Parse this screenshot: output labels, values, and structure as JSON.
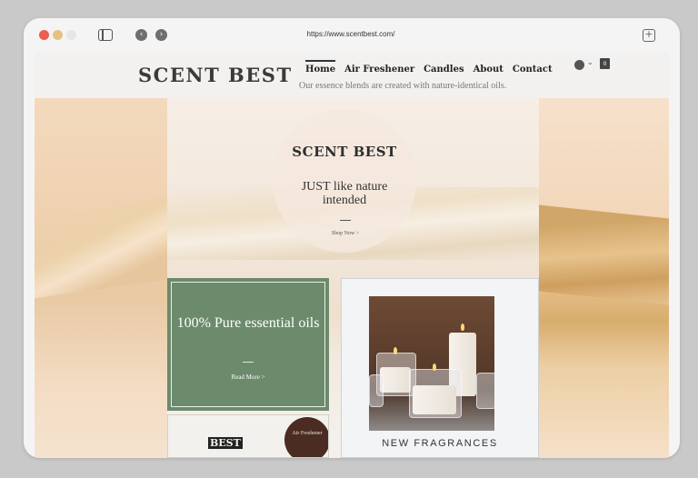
{
  "browser": {
    "url": "https://www.scentbest.com/",
    "back_glyph": "‹",
    "forward_glyph": "›",
    "newtab_glyph": "+"
  },
  "header": {
    "logo": "SCENT BEST",
    "menu": [
      "Home",
      "Air Freshener",
      "Candles",
      "About",
      "Contact"
    ],
    "tagline": "Our essence blends are created with nature-identical oils.",
    "chevron": "⌄",
    "cart_count": "0"
  },
  "hero": {
    "title": "SCENT BEST",
    "subtitle": "JUST like nature intended",
    "cta": "Shop Now >"
  },
  "cards": {
    "oils": {
      "title": "100% Pure essential oils",
      "link": "Read More >"
    },
    "fragrances": {
      "title": "NEW FRAGRANCES"
    },
    "bottom": {
      "logo": "BEST",
      "badge": "Air Freshener"
    }
  },
  "colors": {
    "accent_green": "#6c8a6c",
    "badge_brown": "#4a2c22"
  }
}
